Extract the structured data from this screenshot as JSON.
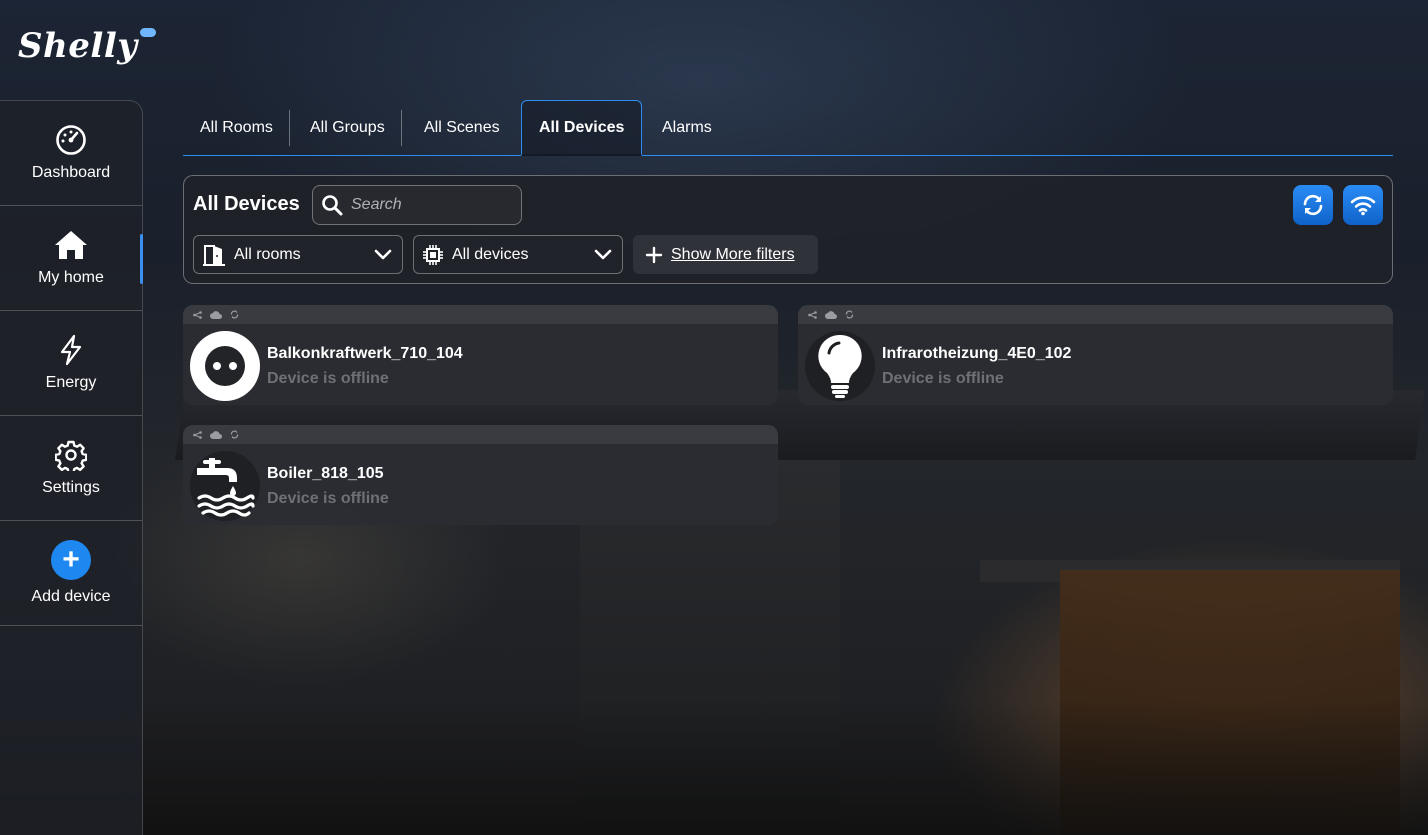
{
  "app": {
    "logo_text": "Shelly"
  },
  "sidebar": {
    "items": [
      {
        "label": "Dashboard",
        "icon": "dashboard-gauge-icon"
      },
      {
        "label": "My home",
        "icon": "home-icon",
        "active": true
      },
      {
        "label": "Energy",
        "icon": "lightning-icon"
      },
      {
        "label": "Settings",
        "icon": "gear-icon"
      },
      {
        "label": "Add device",
        "icon": "plus-icon"
      }
    ]
  },
  "tabs": [
    {
      "label": "All Rooms"
    },
    {
      "label": "All Groups"
    },
    {
      "label": "All Scenes"
    },
    {
      "label": "All Devices",
      "active": true
    },
    {
      "label": "Alarms"
    }
  ],
  "filters": {
    "title": "All Devices",
    "search_placeholder": "Search",
    "rooms_dropdown": "All rooms",
    "devices_dropdown": "All devices",
    "more_filters": "Show More filters"
  },
  "devices": [
    {
      "name": "Balkonkraftwerk_710_104",
      "status": "Device is offline",
      "icon": "power-socket-icon"
    },
    {
      "name": "Infrarotheizung_4E0_102",
      "status": "Device is offline",
      "icon": "light-bulb-icon"
    },
    {
      "name": "Boiler_818_105",
      "status": "Device is offline",
      "icon": "water-faucet-icon"
    }
  ],
  "colors": {
    "accent": "#2d8cf0",
    "button_blue": "#1e88f0",
    "offline_text": "#6e7076"
  }
}
